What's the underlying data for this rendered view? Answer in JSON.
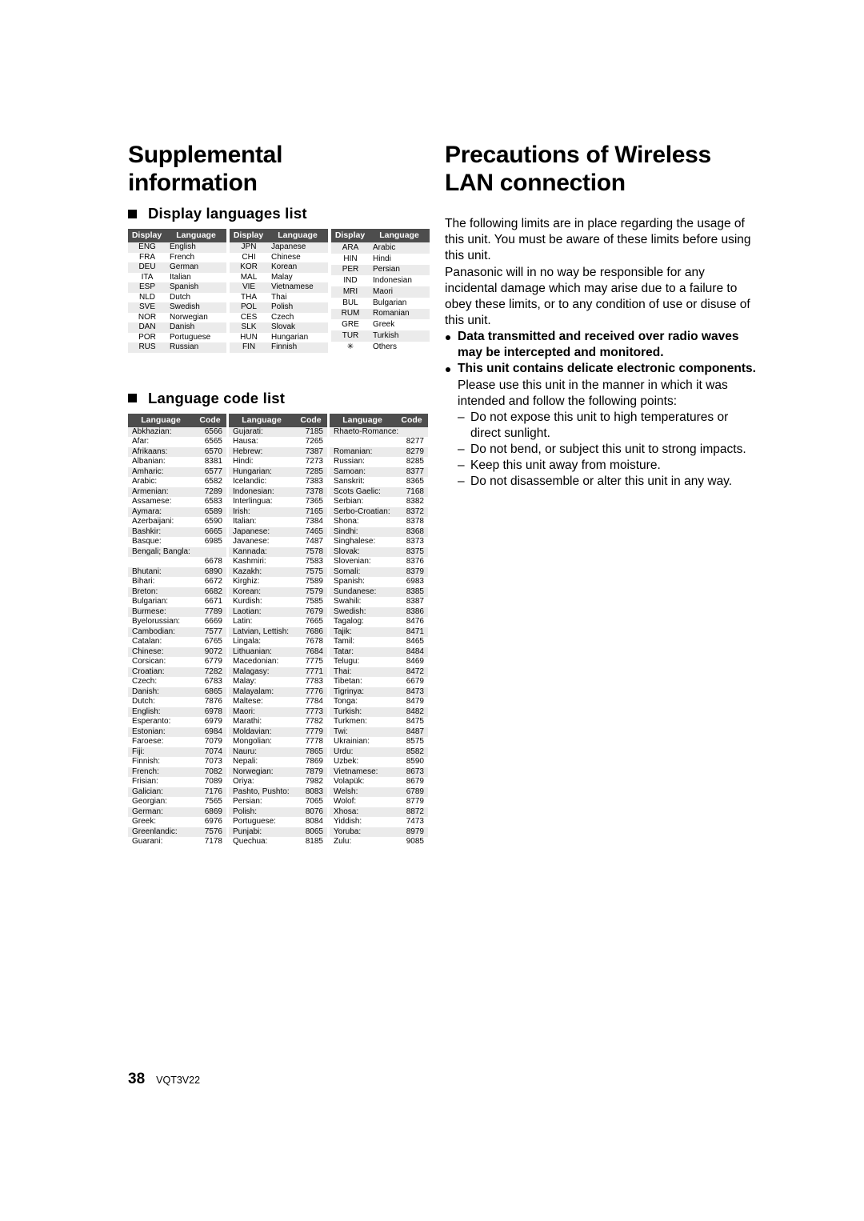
{
  "page": {
    "number": "38",
    "doc_id": "VQT3V22"
  },
  "left_column": {
    "title_line1": "Supplemental",
    "title_line2": "information",
    "display_languages": {
      "heading": "Display languages list",
      "headers": [
        "Display",
        "Language"
      ],
      "columns": [
        [
          [
            "ENG",
            "English"
          ],
          [
            "FRA",
            "French"
          ],
          [
            "DEU",
            "German"
          ],
          [
            "ITA",
            "Italian"
          ],
          [
            "ESP",
            "Spanish"
          ],
          [
            "NLD",
            "Dutch"
          ],
          [
            "SVE",
            "Swedish"
          ],
          [
            "NOR",
            "Norwegian"
          ],
          [
            "DAN",
            "Danish"
          ],
          [
            "POR",
            "Portuguese"
          ],
          [
            "RUS",
            "Russian"
          ]
        ],
        [
          [
            "JPN",
            "Japanese"
          ],
          [
            "CHI",
            "Chinese"
          ],
          [
            "KOR",
            "Korean"
          ],
          [
            "MAL",
            "Malay"
          ],
          [
            "VIE",
            "Vietnamese"
          ],
          [
            "THA",
            "Thai"
          ],
          [
            "POL",
            "Polish"
          ],
          [
            "CES",
            "Czech"
          ],
          [
            "SLK",
            "Slovak"
          ],
          [
            "HUN",
            "Hungarian"
          ],
          [
            "FIN",
            "Finnish"
          ]
        ],
        [
          [
            "ARA",
            "Arabic"
          ],
          [
            "HIN",
            "Hindi"
          ],
          [
            "PER",
            "Persian"
          ],
          [
            "IND",
            "Indonesian"
          ],
          [
            "MRI",
            "Maori"
          ],
          [
            "BUL",
            "Bulgarian"
          ],
          [
            "RUM",
            "Romanian"
          ],
          [
            "GRE",
            "Greek"
          ],
          [
            "TUR",
            "Turkish"
          ],
          [
            "✳",
            "Others"
          ]
        ]
      ]
    },
    "language_codes": {
      "heading": "Language code list",
      "headers": [
        "Language",
        "Code"
      ],
      "columns": [
        [
          [
            "Abkhazian:",
            "6566"
          ],
          [
            "Afar:",
            "6565"
          ],
          [
            "Afrikaans:",
            "6570"
          ],
          [
            "Albanian:",
            "8381"
          ],
          [
            "Amharic:",
            "6577"
          ],
          [
            "Arabic:",
            "6582"
          ],
          [
            "Armenian:",
            "7289"
          ],
          [
            "Assamese:",
            "6583"
          ],
          [
            "Aymara:",
            "6589"
          ],
          [
            "Azerbaijani:",
            "6590"
          ],
          [
            "Bashkir:",
            "6665"
          ],
          [
            "Basque:",
            "6985"
          ],
          [
            "Bengali; Bangla:",
            "6678"
          ],
          [
            "Bhutani:",
            "6890"
          ],
          [
            "Bihari:",
            "6672"
          ],
          [
            "Breton:",
            "6682"
          ],
          [
            "Bulgarian:",
            "6671"
          ],
          [
            "Burmese:",
            "7789"
          ],
          [
            "Byelorussian:",
            "6669"
          ],
          [
            "Cambodian:",
            "7577"
          ],
          [
            "Catalan:",
            "6765"
          ],
          [
            "Chinese:",
            "9072"
          ],
          [
            "Corsican:",
            "6779"
          ],
          [
            "Croatian:",
            "7282"
          ],
          [
            "Czech:",
            "6783"
          ],
          [
            "Danish:",
            "6865"
          ],
          [
            "Dutch:",
            "7876"
          ],
          [
            "English:",
            "6978"
          ],
          [
            "Esperanto:",
            "6979"
          ],
          [
            "Estonian:",
            "6984"
          ],
          [
            "Faroese:",
            "7079"
          ],
          [
            "Fiji:",
            "7074"
          ],
          [
            "Finnish:",
            "7073"
          ],
          [
            "French:",
            "7082"
          ],
          [
            "Frisian:",
            "7089"
          ],
          [
            "Galician:",
            "7176"
          ],
          [
            "Georgian:",
            "7565"
          ],
          [
            "German:",
            "6869"
          ],
          [
            "Greek:",
            "6976"
          ],
          [
            "Greenlandic:",
            "7576"
          ],
          [
            "Guarani:",
            "7178"
          ]
        ],
        [
          [
            "Gujarati:",
            "7185"
          ],
          [
            "Hausa:",
            "7265"
          ],
          [
            "Hebrew:",
            "7387"
          ],
          [
            "Hindi:",
            "7273"
          ],
          [
            "Hungarian:",
            "7285"
          ],
          [
            "Icelandic:",
            "7383"
          ],
          [
            "Indonesian:",
            "7378"
          ],
          [
            "Interlingua:",
            "7365"
          ],
          [
            "Irish:",
            "7165"
          ],
          [
            "Italian:",
            "7384"
          ],
          [
            "Japanese:",
            "7465"
          ],
          [
            "Javanese:",
            "7487"
          ],
          [
            "Kannada:",
            "7578"
          ],
          [
            "Kashmiri:",
            "7583"
          ],
          [
            "Kazakh:",
            "7575"
          ],
          [
            "Kirghiz:",
            "7589"
          ],
          [
            "Korean:",
            "7579"
          ],
          [
            "Kurdish:",
            "7585"
          ],
          [
            "Laotian:",
            "7679"
          ],
          [
            "Latin:",
            "7665"
          ],
          [
            "Latvian, Lettish:",
            "7686"
          ],
          [
            "Lingala:",
            "7678"
          ],
          [
            "Lithuanian:",
            "7684"
          ],
          [
            "Macedonian:",
            "7775"
          ],
          [
            "Malagasy:",
            "7771"
          ],
          [
            "Malay:",
            "7783"
          ],
          [
            "Malayalam:",
            "7776"
          ],
          [
            "Maltese:",
            "7784"
          ],
          [
            "Maori:",
            "7773"
          ],
          [
            "Marathi:",
            "7782"
          ],
          [
            "Moldavian:",
            "7779"
          ],
          [
            "Mongolian:",
            "7778"
          ],
          [
            "Nauru:",
            "7865"
          ],
          [
            "Nepali:",
            "7869"
          ],
          [
            "Norwegian:",
            "7879"
          ],
          [
            "Oriya:",
            "7982"
          ],
          [
            "Pashto, Pushto:",
            "8083"
          ],
          [
            "Persian:",
            "7065"
          ],
          [
            "Polish:",
            "8076"
          ],
          [
            "Portuguese:",
            "8084"
          ],
          [
            "Punjabi:",
            "8065"
          ],
          [
            "Quechua:",
            "8185"
          ]
        ],
        [
          [
            "Rhaeto-Romance:",
            "8277"
          ],
          [
            "Romanian:",
            "8279"
          ],
          [
            "Russian:",
            "8285"
          ],
          [
            "Samoan:",
            "8377"
          ],
          [
            "Sanskrit:",
            "8365"
          ],
          [
            "Scots Gaelic:",
            "7168"
          ],
          [
            "Serbian:",
            "8382"
          ],
          [
            "Serbo-Croatian:",
            "8372"
          ],
          [
            "Shona:",
            "8378"
          ],
          [
            "Sindhi:",
            "8368"
          ],
          [
            "Singhalese:",
            "8373"
          ],
          [
            "Slovak:",
            "8375"
          ],
          [
            "Slovenian:",
            "8376"
          ],
          [
            "Somali:",
            "8379"
          ],
          [
            "Spanish:",
            "6983"
          ],
          [
            "Sundanese:",
            "8385"
          ],
          [
            "Swahili:",
            "8387"
          ],
          [
            "Swedish:",
            "8386"
          ],
          [
            "Tagalog:",
            "8476"
          ],
          [
            "Tajik:",
            "8471"
          ],
          [
            "Tamil:",
            "8465"
          ],
          [
            "Tatar:",
            "8484"
          ],
          [
            "Telugu:",
            "8469"
          ],
          [
            "Thai:",
            "8472"
          ],
          [
            "Tibetan:",
            "6679"
          ],
          [
            "Tigrinya:",
            "8473"
          ],
          [
            "Tonga:",
            "8479"
          ],
          [
            "Turkish:",
            "8482"
          ],
          [
            "Turkmen:",
            "8475"
          ],
          [
            "Twi:",
            "8487"
          ],
          [
            "Ukrainian:",
            "8575"
          ],
          [
            "Urdu:",
            "8582"
          ],
          [
            "Uzbek:",
            "8590"
          ],
          [
            "Vietnamese:",
            "8673"
          ],
          [
            "Volapük:",
            "8679"
          ],
          [
            "Welsh:",
            "6789"
          ],
          [
            "Wolof:",
            "8779"
          ],
          [
            "Xhosa:",
            "8872"
          ],
          [
            "Yiddish:",
            "7473"
          ],
          [
            "Yoruba:",
            "8979"
          ],
          [
            "Zulu:",
            "9085"
          ]
        ]
      ],
      "wrapped_rows": [
        "Bengali; Bangla:",
        "Rhaeto-Romance:"
      ]
    }
  },
  "right_column": {
    "title_line1": "Precautions of Wireless",
    "title_line2": "LAN connection",
    "intro_paragraph_1": "The following limits are in place regarding the usage of this unit. You must be aware of these limits before using this unit.",
    "intro_paragraph_2": "Panasonic will in no way be responsible for any incidental damage which may arise due to a failure to obey these limits, or to any condition of use or disuse of this unit.",
    "bullets": [
      {
        "bold_text": "Data transmitted and received over radio waves may be intercepted and monitored.",
        "sub_text": ""
      },
      {
        "bold_text": "This unit contains delicate electronic components.",
        "sub_text": "Please use this unit in the manner in which it was intended and follow the following points:"
      }
    ],
    "dash_items": [
      "Do not expose this unit to high temperatures or direct sunlight.",
      "Do not bend, or subject this unit to strong impacts.",
      "Keep this unit away from moisture.",
      "Do not disassemble or alter this unit in any way."
    ]
  }
}
